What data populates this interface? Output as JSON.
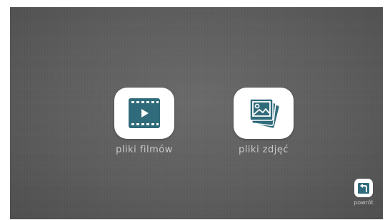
{
  "tiles": [
    {
      "label": "pliki filmów",
      "icon": "film-icon"
    },
    {
      "label": "pliki zdjęć",
      "icon": "photos-icon"
    }
  ],
  "back": {
    "label": "powrót",
    "icon": "back-icon"
  },
  "colors": {
    "background": "#5f5f5f",
    "tile_bg": "#ffffff",
    "icon_accent": "#2f6b7a",
    "label_text": "#c8c8c8"
  }
}
